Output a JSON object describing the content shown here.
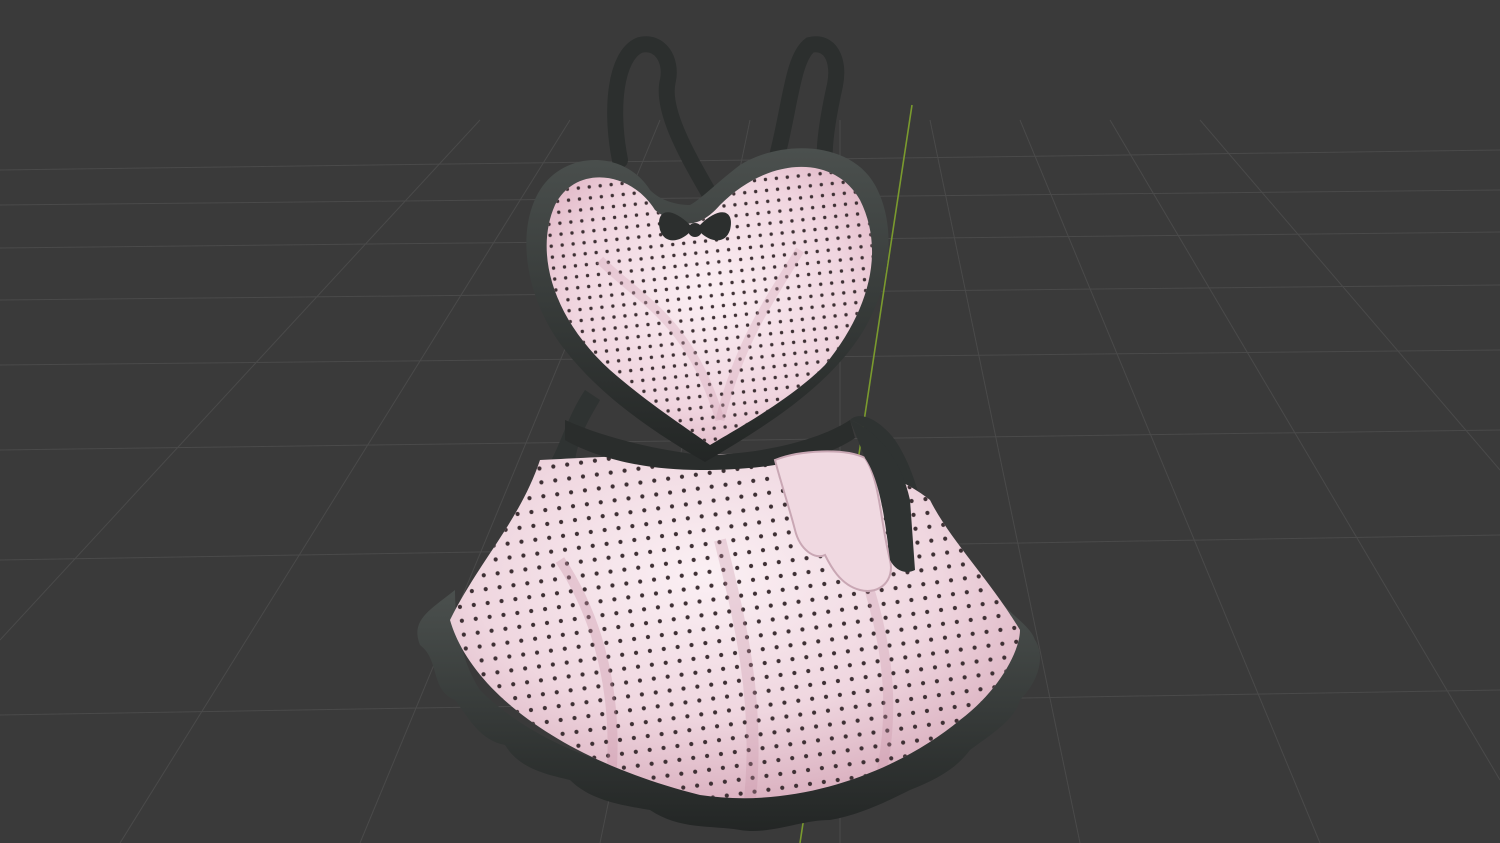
{
  "viewport": {
    "background_color": "#3a3a3a",
    "grid_line_color": "#4a4a4a",
    "y_axis_color": "#7a9a2e"
  },
  "model": {
    "fabric_base_color": "#f1dde5",
    "fabric_shadow_color": "#d7a9b9",
    "polka_dot_color": "#3e3034",
    "trim_color": "#2c2f2e",
    "trim_highlight_color": "#5f6462",
    "pocket_color": "#f0d9e1"
  }
}
